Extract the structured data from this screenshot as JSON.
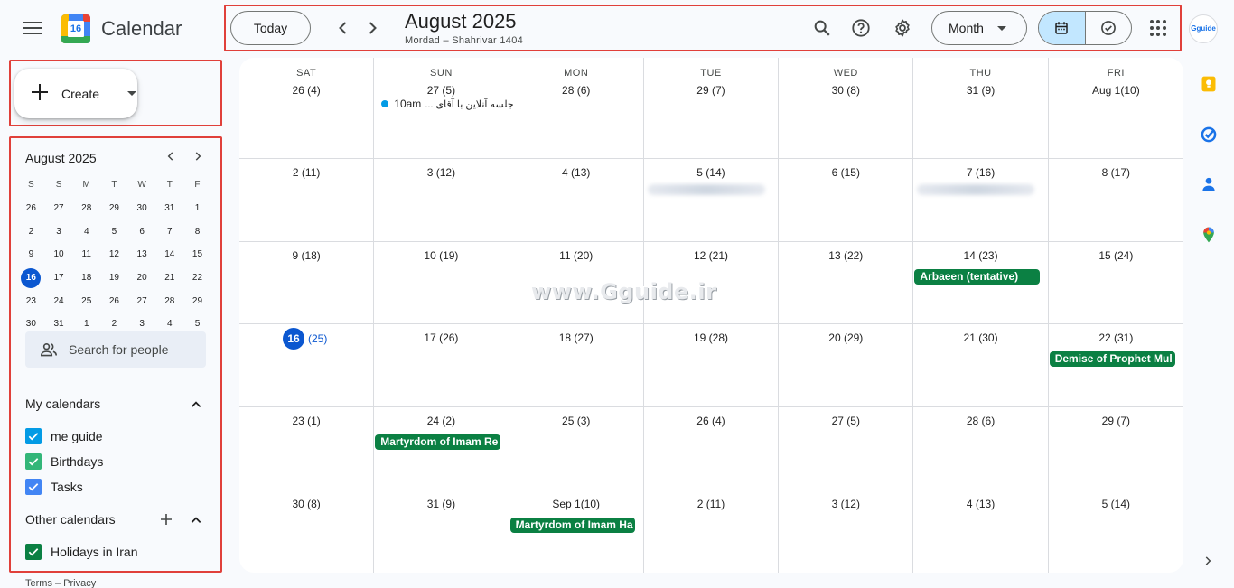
{
  "app": {
    "title": "Calendar",
    "logo_day": "16"
  },
  "toolbar": {
    "today_label": "Today",
    "month_title": "August 2025",
    "month_subtitle": "Mordad – Shahrivar 1404",
    "view_label": "Month"
  },
  "avatar_text": "Gguide",
  "create_label": "Create",
  "mini_calendar": {
    "title": "August 2025",
    "weekday_heads": [
      "S",
      "S",
      "M",
      "T",
      "W",
      "T",
      "F"
    ],
    "weeks": [
      [
        "26",
        "27",
        "28",
        "29",
        "30",
        "31",
        "1"
      ],
      [
        "2",
        "3",
        "4",
        "5",
        "6",
        "7",
        "8"
      ],
      [
        "9",
        "10",
        "11",
        "12",
        "13",
        "14",
        "15"
      ],
      [
        "16",
        "17",
        "18",
        "19",
        "20",
        "21",
        "22"
      ],
      [
        "23",
        "24",
        "25",
        "26",
        "27",
        "28",
        "29"
      ],
      [
        "30",
        "31",
        "1",
        "2",
        "3",
        "4",
        "5"
      ]
    ],
    "today": "16"
  },
  "search_people_label": "Search for people",
  "my_calendars": {
    "title": "My calendars",
    "items": [
      {
        "label": "me guide",
        "color": "#039be5"
      },
      {
        "label": "Birthdays",
        "color": "#33b679"
      },
      {
        "label": "Tasks",
        "color": "#4285f4"
      }
    ]
  },
  "other_calendars": {
    "title": "Other calendars",
    "items": [
      {
        "label": "Holidays in Iran",
        "color": "#0b8043"
      }
    ]
  },
  "footer": "Terms – Privacy",
  "month_grid": {
    "weekdays": [
      "SAT",
      "SUN",
      "MON",
      "TUE",
      "WED",
      "THU",
      "FRI"
    ],
    "weeks": [
      [
        {
          "day": "26 (4)"
        },
        {
          "day": "27 (5)",
          "dot_event": {
            "time": "10am",
            "title": "جلسه آنلاین با آقای ..."
          }
        },
        {
          "day": "28 (6)"
        },
        {
          "day": "29 (7)"
        },
        {
          "day": "30 (8)"
        },
        {
          "day": "31 (9)"
        },
        {
          "day": "Aug 1(10)"
        }
      ],
      [
        {
          "day": "2 (11)"
        },
        {
          "day": "3 (12)"
        },
        {
          "day": "4 (13)"
        },
        {
          "day": "5 (14)",
          "blurred": true
        },
        {
          "day": "6 (15)"
        },
        {
          "day": "7 (16)",
          "blurred": true
        },
        {
          "day": "8 (17)"
        }
      ],
      [
        {
          "day": "9 (18)"
        },
        {
          "day": "10 (19)"
        },
        {
          "day": "11 (20)"
        },
        {
          "day": "12 (21)"
        },
        {
          "day": "13 (22)"
        },
        {
          "day": "14 (23)",
          "chip": "Arbaeen (tentative)"
        },
        {
          "day": "15 (24)"
        }
      ],
      [
        {
          "day": "16",
          "rest": "(25)",
          "today": true
        },
        {
          "day": "17 (26)"
        },
        {
          "day": "18 (27)"
        },
        {
          "day": "19 (28)"
        },
        {
          "day": "20 (29)"
        },
        {
          "day": "21 (30)"
        },
        {
          "day": "22 (31)",
          "chip": "Demise of Prophet Mul"
        }
      ],
      [
        {
          "day": "23 (1)"
        },
        {
          "day": "24 (2)",
          "chip": "Martyrdom of Imam Re"
        },
        {
          "day": "25 (3)"
        },
        {
          "day": "26 (4)"
        },
        {
          "day": "27 (5)"
        },
        {
          "day": "28 (6)"
        },
        {
          "day": "29 (7)"
        }
      ],
      [
        {
          "day": "30 (8)"
        },
        {
          "day": "31 (9)"
        },
        {
          "day": "Sep 1(10)",
          "chip": "Martyrdom of Imam Ha"
        },
        {
          "day": "2 (11)"
        },
        {
          "day": "3 (12)"
        },
        {
          "day": "4 (13)"
        },
        {
          "day": "5 (14)"
        }
      ]
    ]
  },
  "watermark": "www.Gguide.ir",
  "colors": {
    "accent": "#0b57d0",
    "holiday_chip": "#0b8043",
    "highlight": "#e0403a",
    "active_toggle": "#c2e7ff"
  }
}
